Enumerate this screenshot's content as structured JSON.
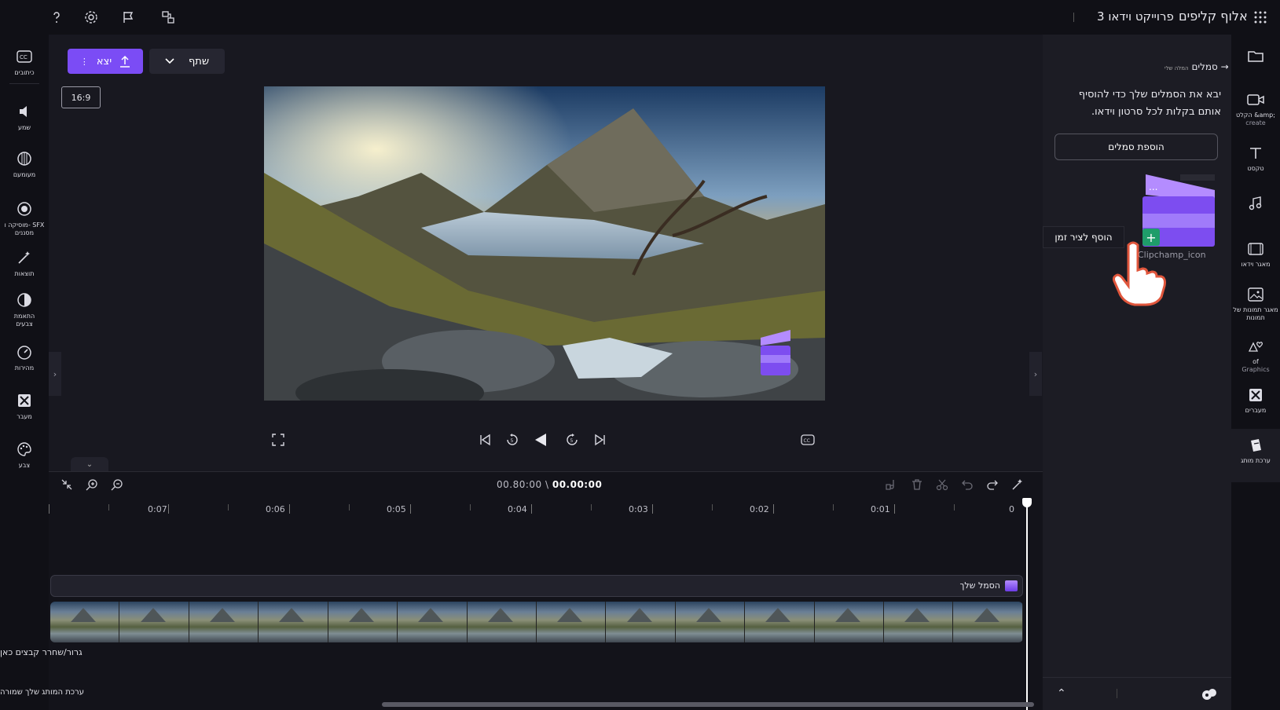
{
  "topbar": {
    "app_name": "אלוף קליפים",
    "project_name": "פרוייקט וידאו 3",
    "icons": [
      "apps-grid-icon",
      "pages-icon",
      "flag-icon",
      "gear-icon",
      "help-icon"
    ]
  },
  "left_rail": {
    "items": [
      {
        "label": "כיתובים",
        "icon": "captions-icon"
      },
      {
        "label": "שמע",
        "icon": "audio-icon"
      },
      {
        "label": "מעומעם",
        "icon": "fade-icon"
      },
      {
        "label": "מוסיקה ו- SFX",
        "label2": "מסננים",
        "icon": "filters-icon"
      },
      {
        "label": "תוצאות",
        "icon": "effects-icon"
      },
      {
        "label": "התאמת",
        "label2": "צבעים",
        "icon": "adjust-colors-icon"
      },
      {
        "label": "מהירות",
        "icon": "speed-icon"
      },
      {
        "label": "מעבר",
        "icon": "transition-icon"
      },
      {
        "label": "צבע",
        "icon": "palette-icon"
      }
    ]
  },
  "toolbar": {
    "export_label": "יצא",
    "share_label": "שתף",
    "aspect_ratio": "16:9"
  },
  "timeline": {
    "current_time": "00.00:00",
    "total_time": "00.80:00",
    "separator": " \\ ",
    "ruler_labels": [
      "0",
      "0:01",
      "0:02",
      "0:03",
      "0:04",
      "0:05",
      "0:06",
      "0:07"
    ],
    "logo_track_label": "הסמל שלך",
    "drop_text": "גרור/שחרר קבצים כאן",
    "brand_text": "ערכת המותג שלך שמורה"
  },
  "right_panel": {
    "back_label": "סמלים",
    "back_sub": "המלה שלי",
    "description": "יבא את הסמלים שלך כדי להוסיף אותם בקלות לכל סרטון וידאו.",
    "add_button": "הוספת סמלים",
    "logo_caption": "Clipchamp_icon",
    "tooltip": "הוסף לציר זמן"
  },
  "right_rail": {
    "items": [
      {
        "label": "",
        "icon": "folder-icon"
      },
      {
        "label": "הקלט &amp;",
        "label2": "create",
        "icon": "record-create-icon"
      },
      {
        "label": "טקסט",
        "icon": "text-icon"
      },
      {
        "label": "",
        "icon": "music-icon"
      },
      {
        "label": "מאגר וידאו",
        "icon": "stock-video-icon"
      },
      {
        "label": "מאגר תמונות של",
        "label2": "תמונות",
        "icon": "stock-images-icon"
      },
      {
        "label": "of",
        "label2": "Graphics",
        "icon": "graphics-icon"
      },
      {
        "label": "מעברים",
        "icon": "transitions-icon"
      },
      {
        "label": "ערכת מותג",
        "icon": "brand-kit-icon"
      }
    ]
  },
  "colors": {
    "accent": "#7b4cf5",
    "add_green": "#1f9d6a",
    "background": "#101016",
    "panel": "#1c1c24"
  }
}
